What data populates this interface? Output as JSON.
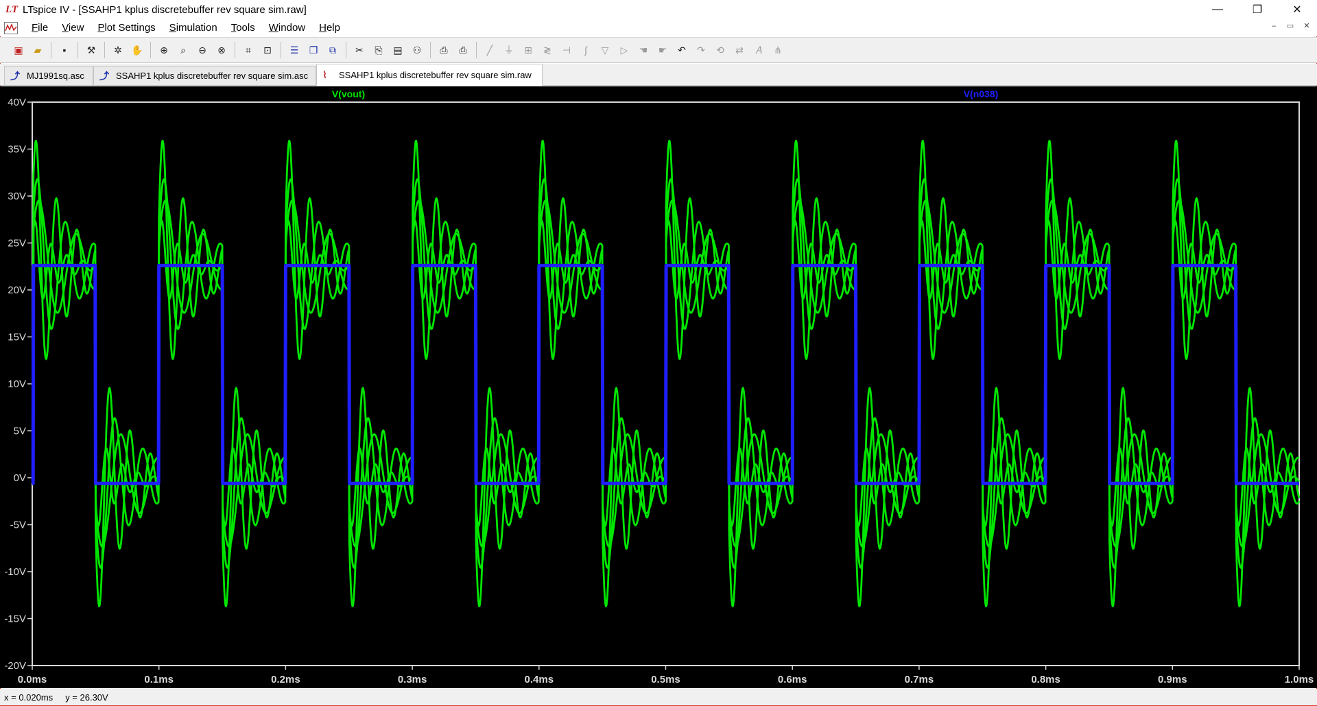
{
  "window": {
    "title": "LTspice IV - [SSAHP1 kplus discretebuffer rev square sim.raw]",
    "controls": {
      "minimize": "—",
      "restore": "❐",
      "close": "✕"
    }
  },
  "menu": {
    "items": [
      "File",
      "View",
      "Plot Settings",
      "Simulation",
      "Tools",
      "Window",
      "Help"
    ],
    "mdi_controls": [
      "–",
      "▭",
      "✕"
    ]
  },
  "tabs": [
    {
      "label": "MJ1991sq.asc",
      "icon": "schematic-icon",
      "active": false
    },
    {
      "label": "SSAHP1 kplus discretebuffer rev square sim.asc",
      "icon": "schematic-icon",
      "active": false
    },
    {
      "label": "SSAHP1 kplus discretebuffer rev square sim.raw",
      "icon": "waveform-icon",
      "active": true
    }
  ],
  "status": {
    "x": "x = 0.020ms",
    "y": "y = 26.30V"
  },
  "chart_data": {
    "type": "line",
    "xlabel": "",
    "ylabel": "",
    "xlim": [
      0,
      1.0
    ],
    "ylim": [
      -20,
      40
    ],
    "x_ticks": [
      "0.0ms",
      "0.1ms",
      "0.2ms",
      "0.3ms",
      "0.4ms",
      "0.5ms",
      "0.6ms",
      "0.7ms",
      "0.8ms",
      "0.9ms",
      "1.0ms"
    ],
    "y_ticks": [
      "40V",
      "35V",
      "30V",
      "25V",
      "20V",
      "15V",
      "10V",
      "5V",
      "0V",
      "-5V",
      "-10V",
      "-15V",
      "-20V"
    ],
    "grid": false,
    "legend_placement": "top",
    "series": [
      {
        "name": "V(vout)",
        "color": "#00e600",
        "description_values": {
          "period_ms": 0.1,
          "duty_high_ms": 0.05,
          "high_level_V": 22.5,
          "low_level_V": -0.3,
          "overshoot_peak_V": 37.5,
          "undershoot_peak_V": -15
        }
      },
      {
        "name": "V(n038)",
        "color": "#1f1fff",
        "description_values": {
          "period_ms": 0.1,
          "duty_high_ms": 0.05,
          "high_level_V": 22.6,
          "low_level_V": -0.6
        }
      }
    ]
  }
}
